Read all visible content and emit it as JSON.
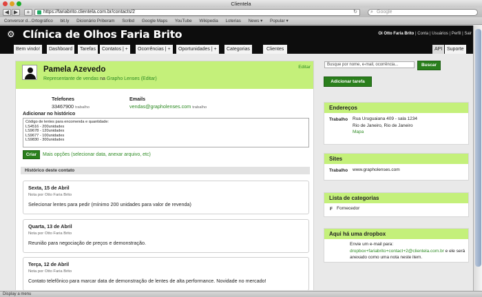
{
  "window": {
    "title": "Clientela"
  },
  "browser": {
    "url": "https://fariabrito.clientela.com.br/contacts/2",
    "search_placeholder": "Google",
    "bookmarks": [
      "Conversor d...Ortográfico",
      "bit.ly",
      "Dicionário Priberam",
      "Scribd",
      "Google Maps",
      "YouTube",
      "Wikipedia",
      "Loterias",
      "News ▾",
      "Popular ▾"
    ]
  },
  "app": {
    "title": "Clínica de Olhos Faria Brito",
    "user_greeting": "Oi Otto Faria Brito",
    "user_links": [
      "Conta",
      "Usuários",
      "Perfil",
      "Sair"
    ]
  },
  "tabs": {
    "welcome": "Bem vindo!",
    "dashboard": "Dashboard",
    "tasks": "Tarefas",
    "contacts": "Contatos",
    "occurrences": "Ocorrências",
    "opportunities": "Oportunidades",
    "categories": "Categorias",
    "clients": "Clientes",
    "api": "API",
    "support": "Suporte",
    "plus": "| +"
  },
  "contact": {
    "name": "Pamela Azevedo",
    "role": "Representante de vendas",
    "at": "na",
    "company": "Grapho Lenses",
    "edit_paren": "(Editar)",
    "edit": "Editar",
    "phones_label": "Telefones",
    "phone": "33467900",
    "phone_type": "trabalho",
    "emails_label": "Emails",
    "email": "vendas@grapholenses.com",
    "email_type": "trabalho"
  },
  "history_form": {
    "label": "Adicionar no histórico",
    "text": "Código de lentes para encomenda e quantidade:\nLS4516 - 200unidades\nLS9678 - 120unidades\nLS9677 - 100unidades\nLS9830 - 300unidades",
    "submit": "Criar",
    "more_options": "Mais opções (selecionar data, anexar arquivo, etc)"
  },
  "history": {
    "title": "Histórico deste contato",
    "notes": [
      {
        "date": "Sexta, 15 de Abril",
        "by": "Nota por Otto Faria Brito",
        "text": "Selecionar lentes para pedir (mínimo 200 unidades para valor de revenda)"
      },
      {
        "date": "Quarta, 13 de Abril",
        "by": "Nota por Otto Faria Brito",
        "text": "Reunião para negociação de preços e demonstração."
      },
      {
        "date": "Terça, 12 de Abril",
        "by": "Nota por Otto Faria Brito",
        "text": "Contato telefônico para marcar data de demonstração de lentes de alta performance. Novidade no mercado!"
      }
    ]
  },
  "sidebar": {
    "search_placeholder": "Busque por nome, e-mail, ocorrência...",
    "search_button": "Buscar",
    "add_task": "Adicionar tarefa",
    "addresses": {
      "title": "Endereços",
      "label": "Trabalho",
      "line1": "Rua Uruguaiana 409 - sala 1234",
      "line2": "Rio de Janeiro, Rio de Janeiro",
      "map": "Mapa"
    },
    "sites": {
      "title": "Sites",
      "label": "Trabalho",
      "url": "www.grapholenses.com"
    },
    "categories": {
      "title": "Lista de categorias",
      "letter": "F",
      "item": "Fornecedor"
    },
    "dropbox": {
      "title": "Aqui há uma dropbox",
      "line1": "Envie um e-mail para:",
      "address": "dropbox+fariabrito+contact+2@clientela.com.br",
      "line2": "e ele será",
      "line3": "anexado como uma nota neste item."
    }
  },
  "status_bar": "Display a menu"
}
